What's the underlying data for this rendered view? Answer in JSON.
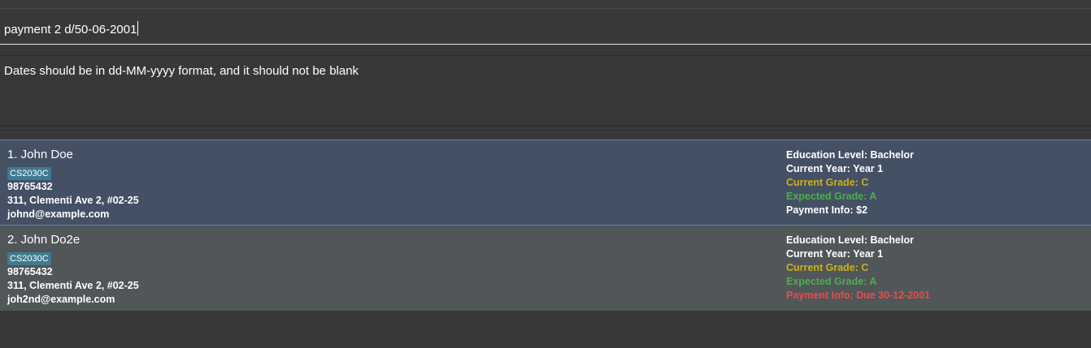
{
  "colors": {
    "background": "#383838",
    "selected_card": "#445064",
    "normal_card": "#515658",
    "tag": "#3e7b91",
    "grade_current": "#c9b21e",
    "grade_expected": "#4caf50",
    "payment_due": "#e84c4c",
    "text": "#ffffff"
  },
  "command": {
    "value": "payment 2 d/50-06-2001"
  },
  "result": {
    "message": "Dates should be in dd-MM-yyyy format, and it should not be blank"
  },
  "persons": [
    {
      "index_name": "1. John Doe",
      "tag": "CS2030C",
      "phone": "98765432",
      "address": "311, Clementi Ave 2, #02-25",
      "email": "johnd@example.com",
      "education": "Education Level: Bachelor",
      "year": "Current Year: Year 1",
      "current_grade": "Current Grade: C",
      "expected_grade": "Expected Grade: A",
      "payment": "Payment Info: $2"
    },
    {
      "index_name": "2. John Do2e",
      "tag": "CS2030C",
      "phone": "98765432",
      "address": "311, Clementi Ave 2, #02-25",
      "email": "joh2nd@example.com",
      "education": "Education Level: Bachelor",
      "year": "Current Year: Year 1",
      "current_grade": "Current Grade: C",
      "expected_grade": "Expected Grade: A",
      "payment": "Payment Info: Due 30-12-2001"
    }
  ]
}
